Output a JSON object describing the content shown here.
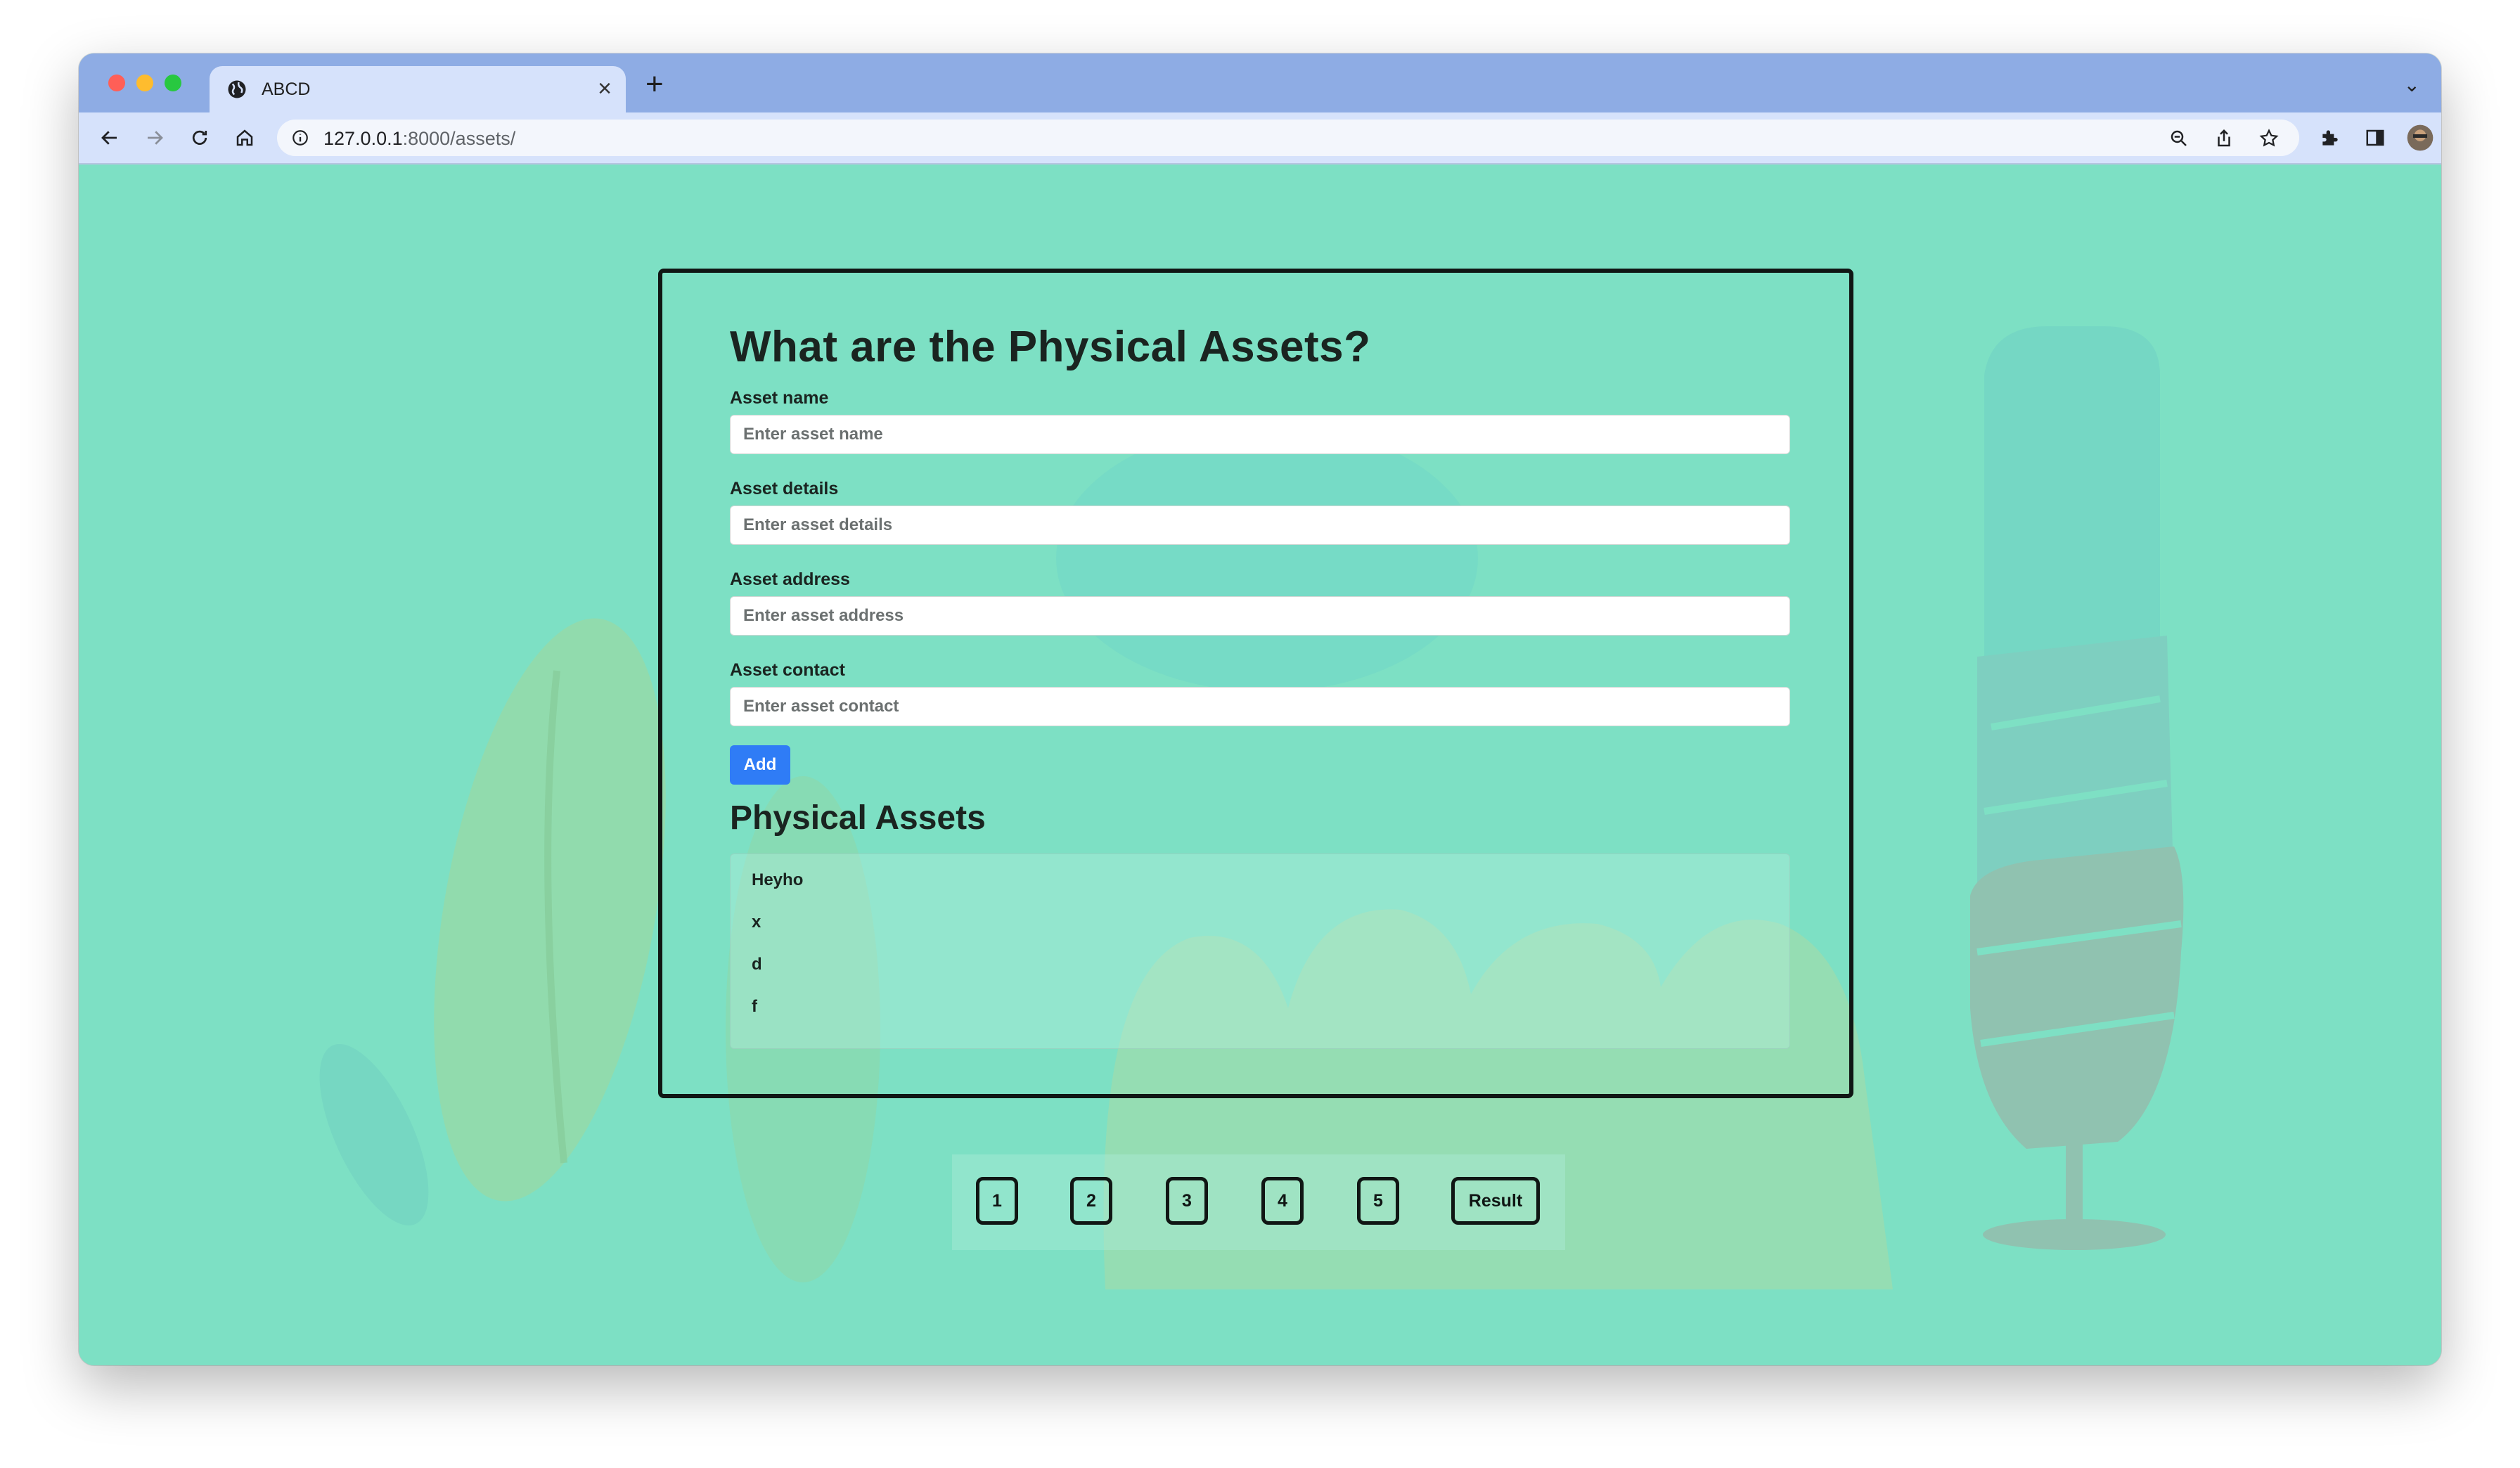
{
  "browser": {
    "tab_title": "ABCD",
    "url_host": "127.0.0.1",
    "url_path": ":8000/assets/"
  },
  "page": {
    "heading": "What are the Physical Assets?",
    "fields": [
      {
        "label": "Asset name",
        "placeholder": "Enter asset name",
        "value": ""
      },
      {
        "label": "Asset details",
        "placeholder": "Enter asset details",
        "value": ""
      },
      {
        "label": "Asset address",
        "placeholder": "Enter asset address",
        "value": ""
      },
      {
        "label": "Asset contact",
        "placeholder": "Enter asset contact",
        "value": ""
      }
    ],
    "add_label": "Add",
    "list_heading": "Physical Assets",
    "assets": [
      "Heyho",
      "x",
      "d",
      "f"
    ]
  },
  "pagination": {
    "pages": [
      "1",
      "2",
      "3",
      "4",
      "5"
    ],
    "result_label": "Result"
  },
  "colors": {
    "page_background": "#7de0c4",
    "primary_button": "#2f7cf6",
    "tab_strip": "#8eace4",
    "toolbar": "#d6e2fb"
  }
}
